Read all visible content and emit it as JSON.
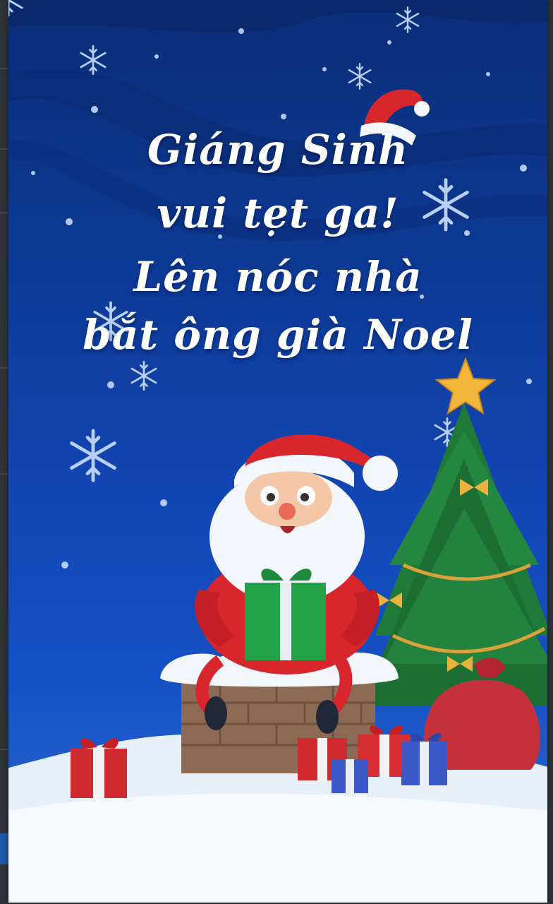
{
  "card": {
    "greeting_lines": [
      "Giáng Sinh",
      "vui tẹt ga!",
      "Lên nóc nhà",
      "bắt ông già Noel"
    ]
  },
  "colors": {
    "sky_top": "#0b2d78",
    "sky_bottom": "#2e6ad0",
    "snow": "#eef5fb",
    "santa_red": "#d8262d",
    "tree_green": "#1f7a3a",
    "star_gold": "#f2b63a"
  },
  "icons": [
    "santa-hat-icon",
    "snowflake-icon",
    "star-icon",
    "gift-icon",
    "santa-claus",
    "christmas-tree",
    "chimney",
    "gift-sack"
  ]
}
